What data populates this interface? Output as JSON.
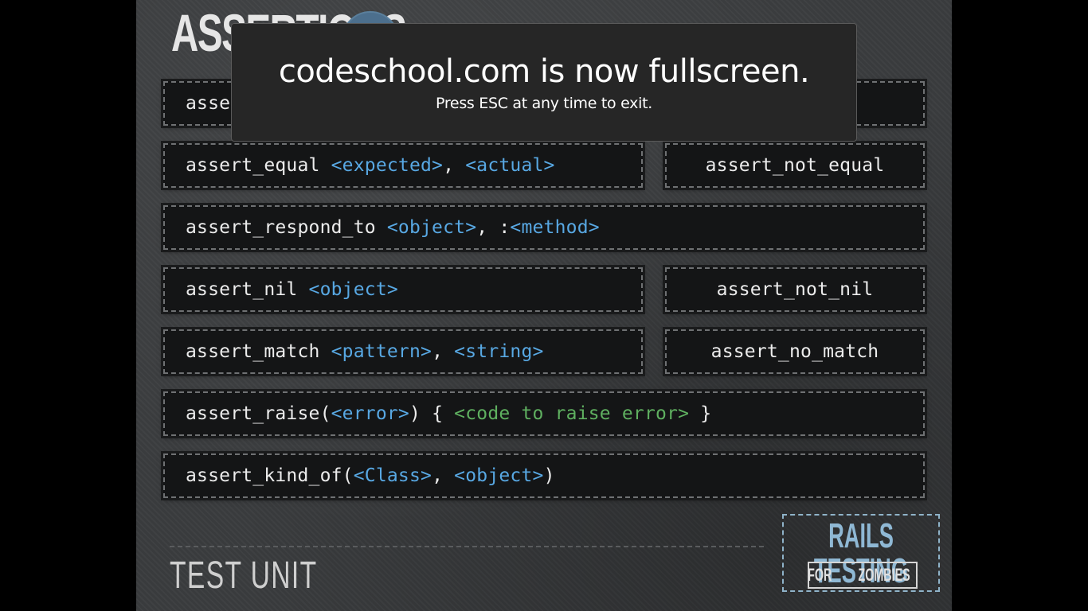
{
  "browser_overlay": {
    "message": "codeschool.com is now fullscreen.",
    "hint": "Press ESC at any time to exit."
  },
  "slide": {
    "title": "ASSERTIONS",
    "rows": [
      {
        "parts": [
          {
            "t": "asse",
            "c": "plain"
          }
        ]
      },
      {
        "parts": [
          {
            "t": "assert_equal ",
            "c": "plain"
          },
          {
            "t": "<expected>",
            "c": "arg"
          },
          {
            "t": ", ",
            "c": "plain"
          },
          {
            "t": "<actual>",
            "c": "arg"
          }
        ],
        "pair": "assert_not_equal"
      },
      {
        "parts": [
          {
            "t": "assert_respond_to ",
            "c": "plain"
          },
          {
            "t": "<object>",
            "c": "arg"
          },
          {
            "t": ", :",
            "c": "plain"
          },
          {
            "t": "<method>",
            "c": "arg"
          }
        ]
      },
      {
        "parts": [
          {
            "t": "assert_nil ",
            "c": "plain"
          },
          {
            "t": "<object>",
            "c": "arg"
          }
        ],
        "pair": "assert_not_nil"
      },
      {
        "parts": [
          {
            "t": "assert_match ",
            "c": "plain"
          },
          {
            "t": "<pattern>",
            "c": "arg"
          },
          {
            "t": ", ",
            "c": "plain"
          },
          {
            "t": "<string>",
            "c": "arg"
          }
        ],
        "pair": "assert_no_match"
      },
      {
        "parts": [
          {
            "t": "assert_raise(",
            "c": "plain"
          },
          {
            "t": "<error>",
            "c": "arg"
          },
          {
            "t": ") { ",
            "c": "plain"
          },
          {
            "t": "<code to raise error>",
            "c": "green"
          },
          {
            "t": " }",
            "c": "plain"
          }
        ]
      },
      {
        "parts": [
          {
            "t": "assert_kind_of(",
            "c": "plain"
          },
          {
            "t": "<Class>",
            "c": "arg"
          },
          {
            "t": ", ",
            "c": "plain"
          },
          {
            "t": "<object>",
            "c": "arg"
          },
          {
            "t": ")",
            "c": "plain"
          }
        ]
      }
    ],
    "footer": "TEST UNIT",
    "logo": {
      "line1": "RAILS TESTING",
      "for": "FOR",
      "zombies": "ZOMBIES"
    }
  },
  "colors": {
    "arg": "#58a8e3",
    "green": "#5fb060",
    "plain": "#ececec"
  }
}
